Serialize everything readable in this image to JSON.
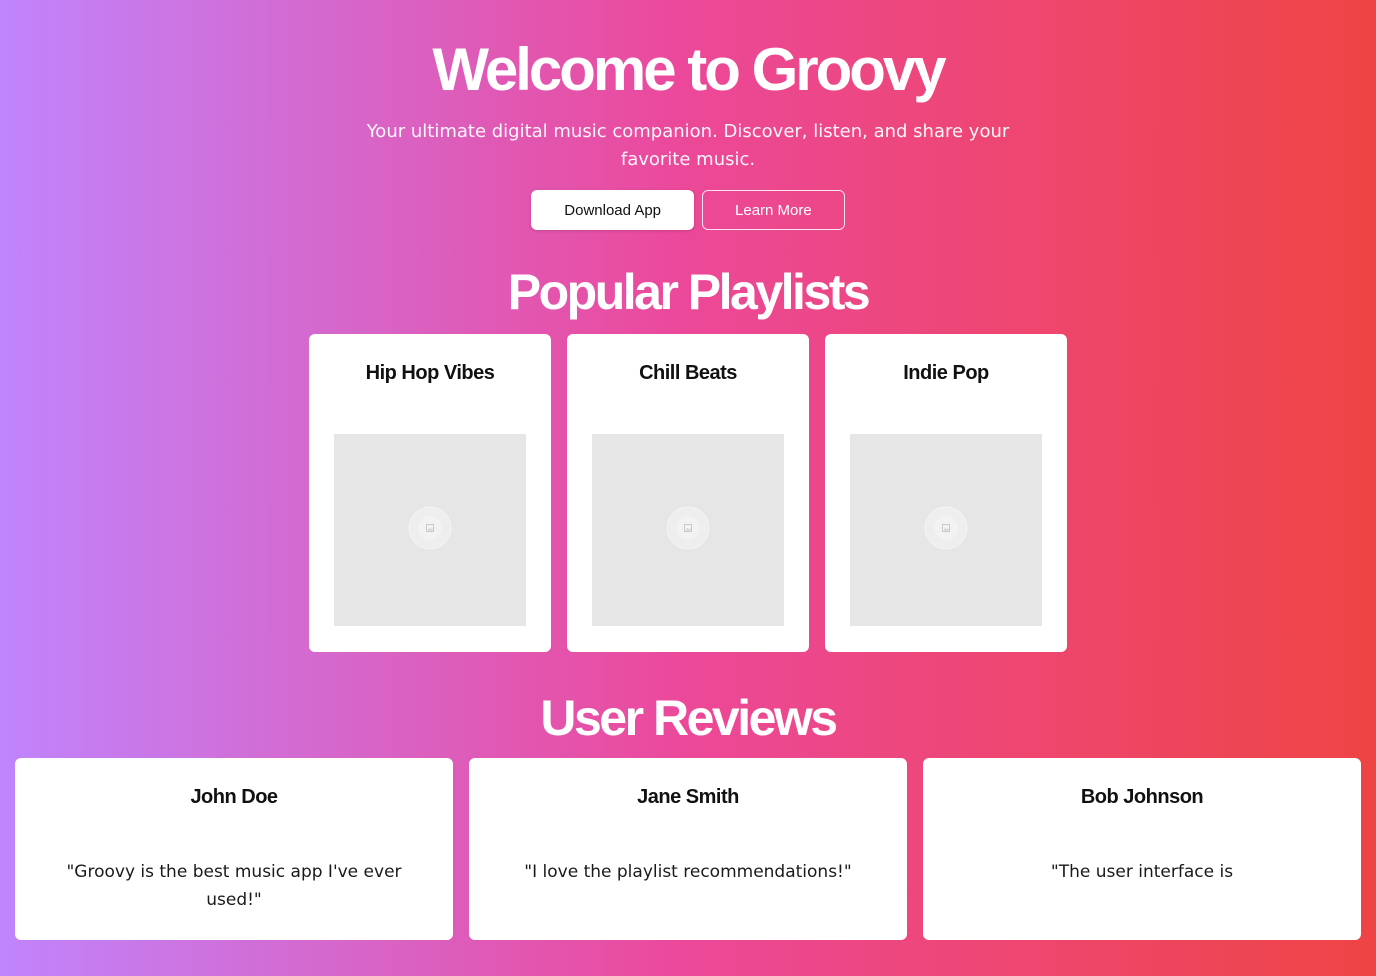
{
  "hero": {
    "title": "Welcome to Groovy",
    "subtitle": "Your ultimate digital music companion. Discover, listen, and share your favorite music.",
    "download_label": "Download App",
    "learn_more_label": "Learn More"
  },
  "playlists": {
    "title": "Popular Playlists",
    "items": [
      {
        "name": "Hip Hop Vibes",
        "cover_icon": "image-placeholder-icon"
      },
      {
        "name": "Chill Beats",
        "cover_icon": "image-placeholder-icon"
      },
      {
        "name": "Indie Pop",
        "cover_icon": "image-placeholder-icon"
      }
    ]
  },
  "reviews": {
    "title": "User Reviews",
    "items": [
      {
        "name": "John Doe",
        "text": "\"Groovy is the best music app I've ever used!\""
      },
      {
        "name": "Jane Smith",
        "text": "\"I love the playlist recommendations!\""
      },
      {
        "name": "Bob Johnson",
        "text": "\"The user interface is"
      }
    ]
  },
  "colors": {
    "gradient_start": "#c084fc",
    "gradient_mid": "#ec4899",
    "gradient_end": "#ef4444",
    "card_bg": "#ffffff",
    "cover_bg": "#e6e6e6"
  }
}
